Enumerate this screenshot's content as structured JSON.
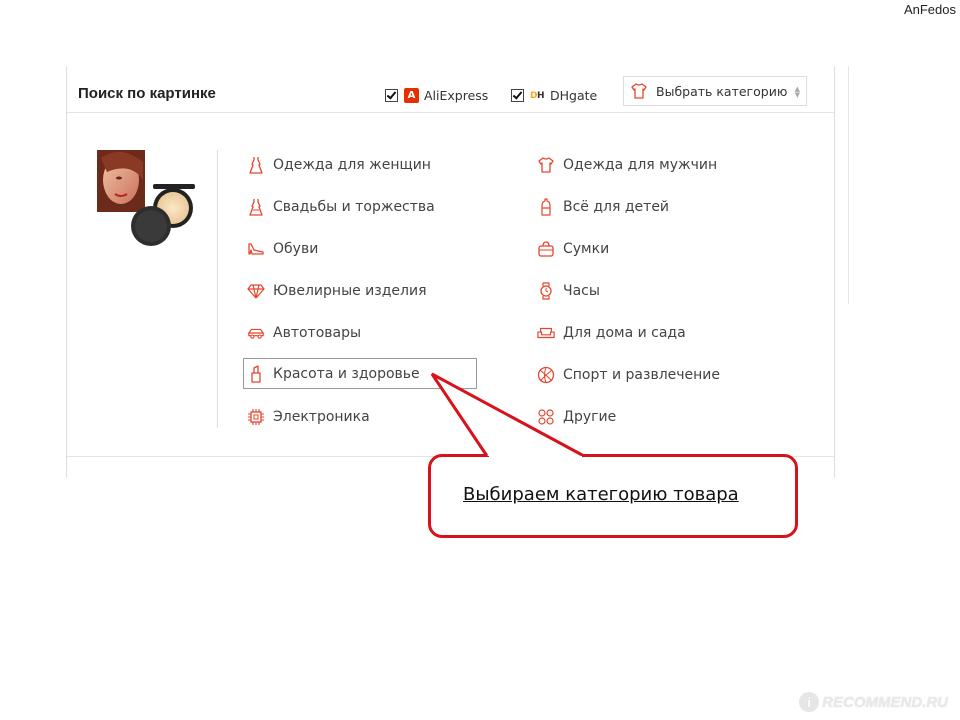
{
  "author": "AnFedos",
  "panel": {
    "title": "Поиск по картинке",
    "sources": [
      {
        "label": "AliExpress",
        "checked": true,
        "icon": "aliexpress-icon"
      },
      {
        "label": "DHgate",
        "checked": true,
        "icon": "dhgate-icon"
      }
    ],
    "dh_logo_d": "D",
    "dh_logo_h": "H",
    "ali_logo_text": "A",
    "category_select": {
      "label": "Выбрать категорию",
      "icon": "tshirt-icon"
    },
    "left_column": [
      {
        "label": "Одежда для женщин",
        "icon": "dress-icon"
      },
      {
        "label": "Свадьбы и торжества",
        "icon": "wedding-dress-icon"
      },
      {
        "label": "Обуви",
        "icon": "shoe-icon"
      },
      {
        "label": "Ювелирные изделия",
        "icon": "diamond-icon"
      },
      {
        "label": "Автотовары",
        "icon": "car-icon"
      },
      {
        "label": "Красота и здоровье",
        "icon": "lipstick-icon",
        "selected": true
      },
      {
        "label": "Электроника",
        "icon": "chip-icon"
      }
    ],
    "right_column": [
      {
        "label": "Одежда для мужчин",
        "icon": "tshirt-icon"
      },
      {
        "label": "Всё для детей",
        "icon": "baby-bottle-icon"
      },
      {
        "label": "Сумки",
        "icon": "bag-icon"
      },
      {
        "label": "Часы",
        "icon": "watch-icon"
      },
      {
        "label": "Для дома и сада",
        "icon": "sofa-icon"
      },
      {
        "label": "Спорт и развлечение",
        "icon": "ball-icon"
      },
      {
        "label": "Другие",
        "icon": "grid-icon"
      }
    ]
  },
  "callout": {
    "text": "Выбираем категорию товара"
  },
  "watermark": {
    "text": "RECOMMEND.RU",
    "logo": "i"
  },
  "colors": {
    "accent": "#e8452c",
    "callout_border": "#d9111b",
    "divider": "#dddddd"
  }
}
